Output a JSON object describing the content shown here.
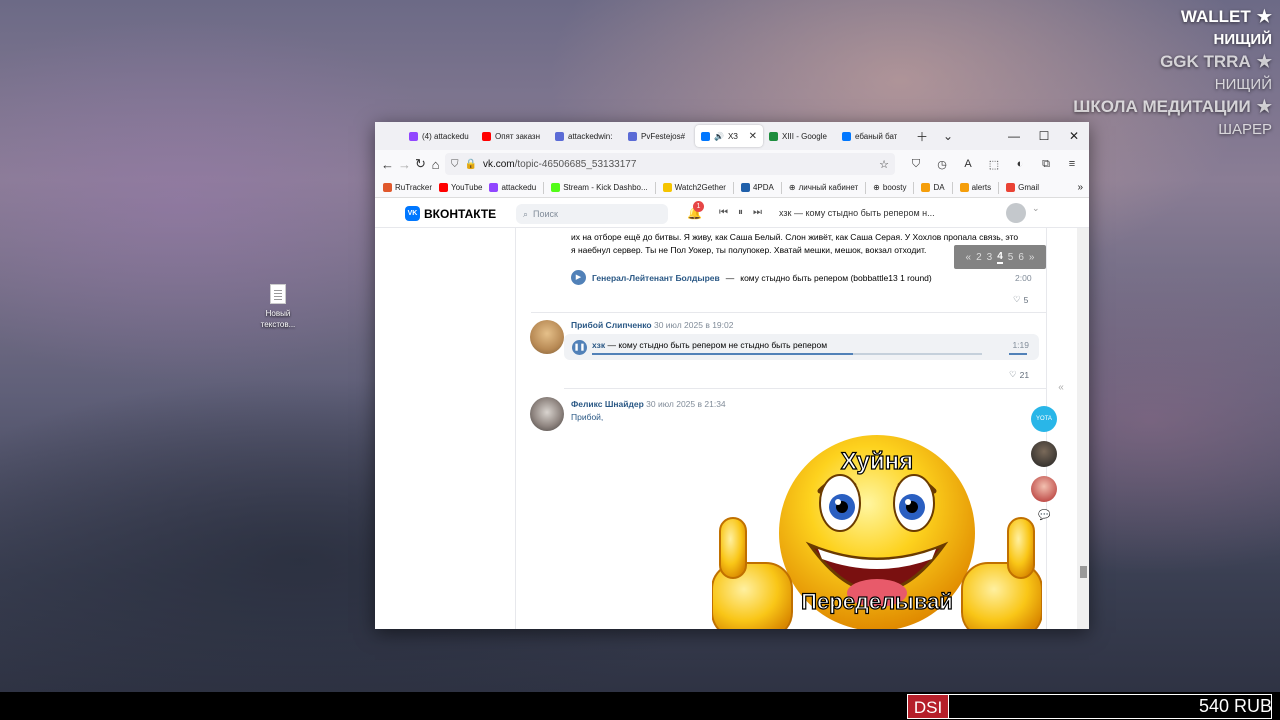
{
  "desktop": {
    "icon_label": "Новый текстов..."
  },
  "overlay": {
    "rows": [
      {
        "title": "WALLET",
        "value": "НИЩИЙ"
      },
      {
        "title": "GGK TRRA",
        "value": "НИЩИЙ"
      },
      {
        "title": "ШКОЛА МЕДИТАЦИИ",
        "value": "ШАРЕР"
      }
    ]
  },
  "bottom": {
    "tag": "DSI",
    "amount": "540 RUB"
  },
  "tabs": [
    {
      "label": "(4) attackedu",
      "color": "#9146ff"
    },
    {
      "label": "Опят заказн",
      "color": "#ff0000"
    },
    {
      "label": "attackedwin:",
      "color": "#5b6bd6"
    },
    {
      "label": "PvFestejos#",
      "color": "#5b6bd6"
    },
    {
      "label": "ХЗ",
      "color": "#0077ff"
    },
    {
      "label": "XIII - Google",
      "color": "#1e8e3e"
    },
    {
      "label": "ебаный бат",
      "color": "#0077ff"
    }
  ],
  "address": {
    "domain": "vk.com",
    "path": "/topic-46506685_53133177"
  },
  "bookmarks": [
    {
      "label": "RuTracker",
      "color": "#e0582c"
    },
    {
      "label": "YouTube",
      "color": "#ff0000"
    },
    {
      "label": "attackedu",
      "color": "#9146ff"
    },
    {
      "label": "Stream - Kick Dashbo...",
      "color": "#53fc18"
    },
    {
      "label": "Watch2Gether",
      "color": "#f5c400"
    },
    {
      "label": "4PDA",
      "color": "#1f5faa"
    },
    {
      "label": "личный кабинет",
      "color": "#666666"
    },
    {
      "label": "boosty",
      "color": "#666666"
    },
    {
      "label": "DA",
      "color": "#f59e0b"
    },
    {
      "label": "alerts",
      "color": "#f59e0b"
    },
    {
      "label": "Gmail",
      "color": "#ea4335"
    }
  ],
  "vk": {
    "logo": "ВКОНТАКТЕ",
    "search_placeholder": "Поиск",
    "notif_count": "1",
    "now_playing": "хзк — кому стыдно быть репером н..."
  },
  "pager": {
    "prev": "«",
    "pages": [
      "2",
      "3"
    ],
    "current": "4",
    "after": [
      "5",
      "6"
    ],
    "next": "»"
  },
  "post": {
    "text_line1": "их на отборе ещё до битвы. Я живу, как Саша Белый. Слон живёт, как Саша Серая. У Хохлов пропала связь, это",
    "text_line2": "я наебнул сервер. Ты не Пол Уокер, ты полупокер. Хватай мешки, мешок, вокзал отходит.",
    "audio_artist": "Генерал-Лейтенант Болдырев",
    "audio_title": "кому стыдно быть репером (bobbattle13 1 round)",
    "audio_duration": "2:00",
    "likes": "5"
  },
  "comments": [
    {
      "author": "Прибой Слипченко",
      "date": "30 июл 2025 в 19:02",
      "audio_artist": "хзк",
      "audio_title": "кому стыдно быть репером не стыдно быть репером",
      "audio_duration": "1:19",
      "progress_fraction": 0.67,
      "likes": "21"
    },
    {
      "author": "Феликс Шнайдер",
      "date": "30 июл 2025 в 21:34",
      "reply_to": "Прибой,",
      "meme_top": "Хуйня",
      "meme_bottom": "Переделывай"
    }
  ],
  "rail": {
    "collapse": "«",
    "yota": "YOTA"
  }
}
